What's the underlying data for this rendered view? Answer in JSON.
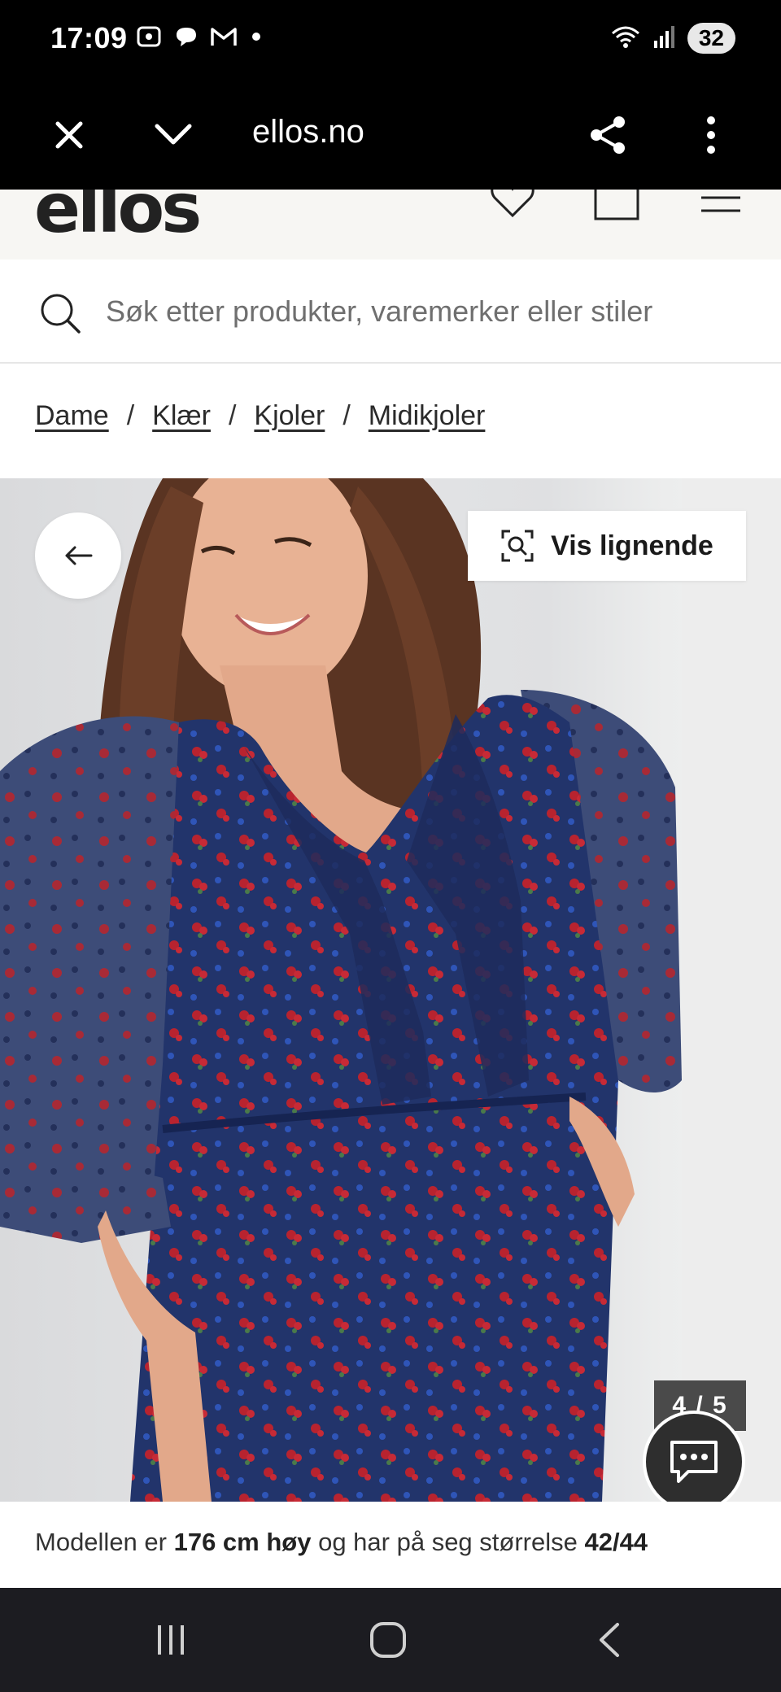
{
  "status_bar": {
    "time": "17:09",
    "battery": "32"
  },
  "browser": {
    "url": "ellos.no"
  },
  "site": {
    "logo": "ellos"
  },
  "search": {
    "placeholder": "Søk etter produkter, varemerker eller stiler"
  },
  "breadcrumb": {
    "items": [
      "Dame",
      "Klær",
      "Kjoler",
      "Midikjoler"
    ],
    "separator": "/"
  },
  "product": {
    "similar_label": "Vis lignende",
    "image_counter": "4 / 5",
    "model_info": {
      "prefix": "Modellen er ",
      "height": "176 cm høy",
      "middle": " og har på seg størrelse ",
      "size": "42/44"
    }
  },
  "colors": {
    "dress_navy": "#22346b",
    "flower_red": "#b8232f"
  }
}
